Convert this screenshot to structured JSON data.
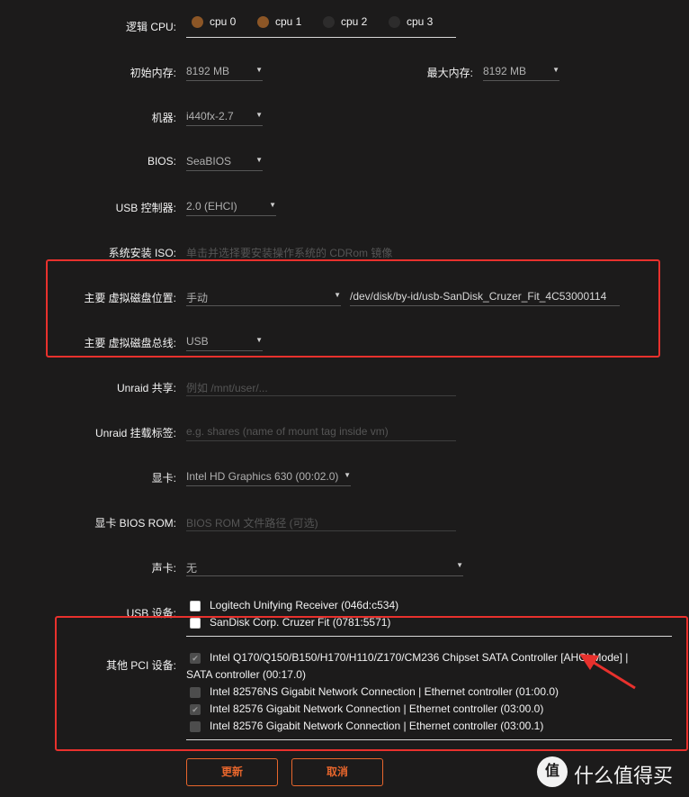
{
  "labels": {
    "logical_cpu": "逻辑 CPU",
    "initial_memory": "初始内存",
    "max_memory": "最大内存",
    "machine": "机器",
    "bios": "BIOS",
    "usb_controller": "USB 控制器",
    "os_install_iso": "系统安装 ISO",
    "primary_vdisk_location": "主要 虚拟磁盘位置",
    "primary_vdisk_bus": "主要 虚拟磁盘总线",
    "unraid_share": "Unraid 共享",
    "unraid_mount_tag": "Unraid 挂载标签",
    "graphics_card": "显卡",
    "graphics_bios_rom": "显卡 BIOS ROM",
    "sound_card": "声卡",
    "usb_devices": "USB 设备",
    "other_pci_devices": "其他 PCI 设备"
  },
  "cpus": [
    {
      "label": "cpu 0",
      "selected": true
    },
    {
      "label": "cpu 1",
      "selected": true
    },
    {
      "label": "cpu 2",
      "selected": false
    },
    {
      "label": "cpu 3",
      "selected": false
    }
  ],
  "fields": {
    "initial_memory": "8192 MB",
    "max_memory": "8192 MB",
    "machine": "i440fx-2.7",
    "bios": "SeaBIOS",
    "usb_controller": "2.0 (EHCI)",
    "os_install_iso_placeholder": "单击并选择要安装操作系统的 CDRom 镜像",
    "vdisk_location": "手动",
    "vdisk_path": "/dev/disk/by-id/usb-SanDisk_Cruzer_Fit_4C53000114",
    "vdisk_bus": "USB",
    "unraid_share_placeholder": "例如 /mnt/user/...",
    "unraid_mount_tag_placeholder": "e.g. shares (name of mount tag inside vm)",
    "graphics_card": "Intel HD Graphics 630 (00:02.0)",
    "graphics_bios_rom_placeholder": "BIOS ROM 文件路径 (可选)",
    "sound_card": "无"
  },
  "usb_devices": [
    {
      "label": "Logitech Unifying Receiver (046d:c534)",
      "checked": false
    },
    {
      "label": "SanDisk Corp. Cruzer Fit (0781:5571)",
      "checked": false
    }
  ],
  "pci_devices": [
    {
      "label": "Intel Q170/Q150/B150/H170/H110/Z170/CM236 Chipset SATA Controller [AHCI Mode] |",
      "label_cont": "SATA controller (00:17.0)",
      "checked": true
    },
    {
      "label": "Intel 82576NS Gigabit Network Connection | Ethernet controller (01:00.0)",
      "checked": false
    },
    {
      "label": "Intel 82576 Gigabit Network Connection | Ethernet controller (03:00.0)",
      "checked": true
    },
    {
      "label": "Intel 82576 Gigabit Network Connection | Ethernet controller (03:00.1)",
      "checked": false
    }
  ],
  "buttons": {
    "update": "更新",
    "cancel": "取消"
  },
  "watermark": {
    "badge": "值",
    "text": "什么值得买"
  },
  "colors": {
    "accent": "#e8662c",
    "annotation_red": "#e8312d",
    "cpu_selected": "#8c5626",
    "background": "#1c1b1b"
  }
}
